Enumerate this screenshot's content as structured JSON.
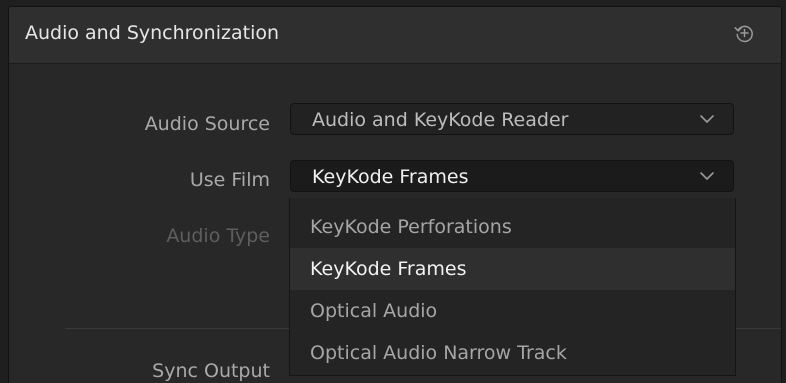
{
  "panel": {
    "title": "Audio and Synchronization",
    "reset_icon": "reset-icon"
  },
  "fields": {
    "audio_source": {
      "label": "Audio Source",
      "value": "Audio and KeyKode Reader"
    },
    "use_film": {
      "label": "Use Film",
      "value": "KeyKode Frames"
    },
    "audio_type": {
      "label": "Audio Type"
    },
    "sync_output": {
      "label": "Sync Output"
    }
  },
  "dropdown": {
    "options": [
      "KeyKode Perforations",
      "KeyKode Frames",
      "Optical Audio",
      "Optical Audio Narrow Track"
    ],
    "selected": "KeyKode Frames"
  },
  "colors": {
    "panel_bg": "#282828",
    "header_bg": "#2f2f2f",
    "label_text": "#a9a9a9",
    "disabled_label": "#5e5e5e",
    "selected_option_bg": "#2f2f2f"
  }
}
